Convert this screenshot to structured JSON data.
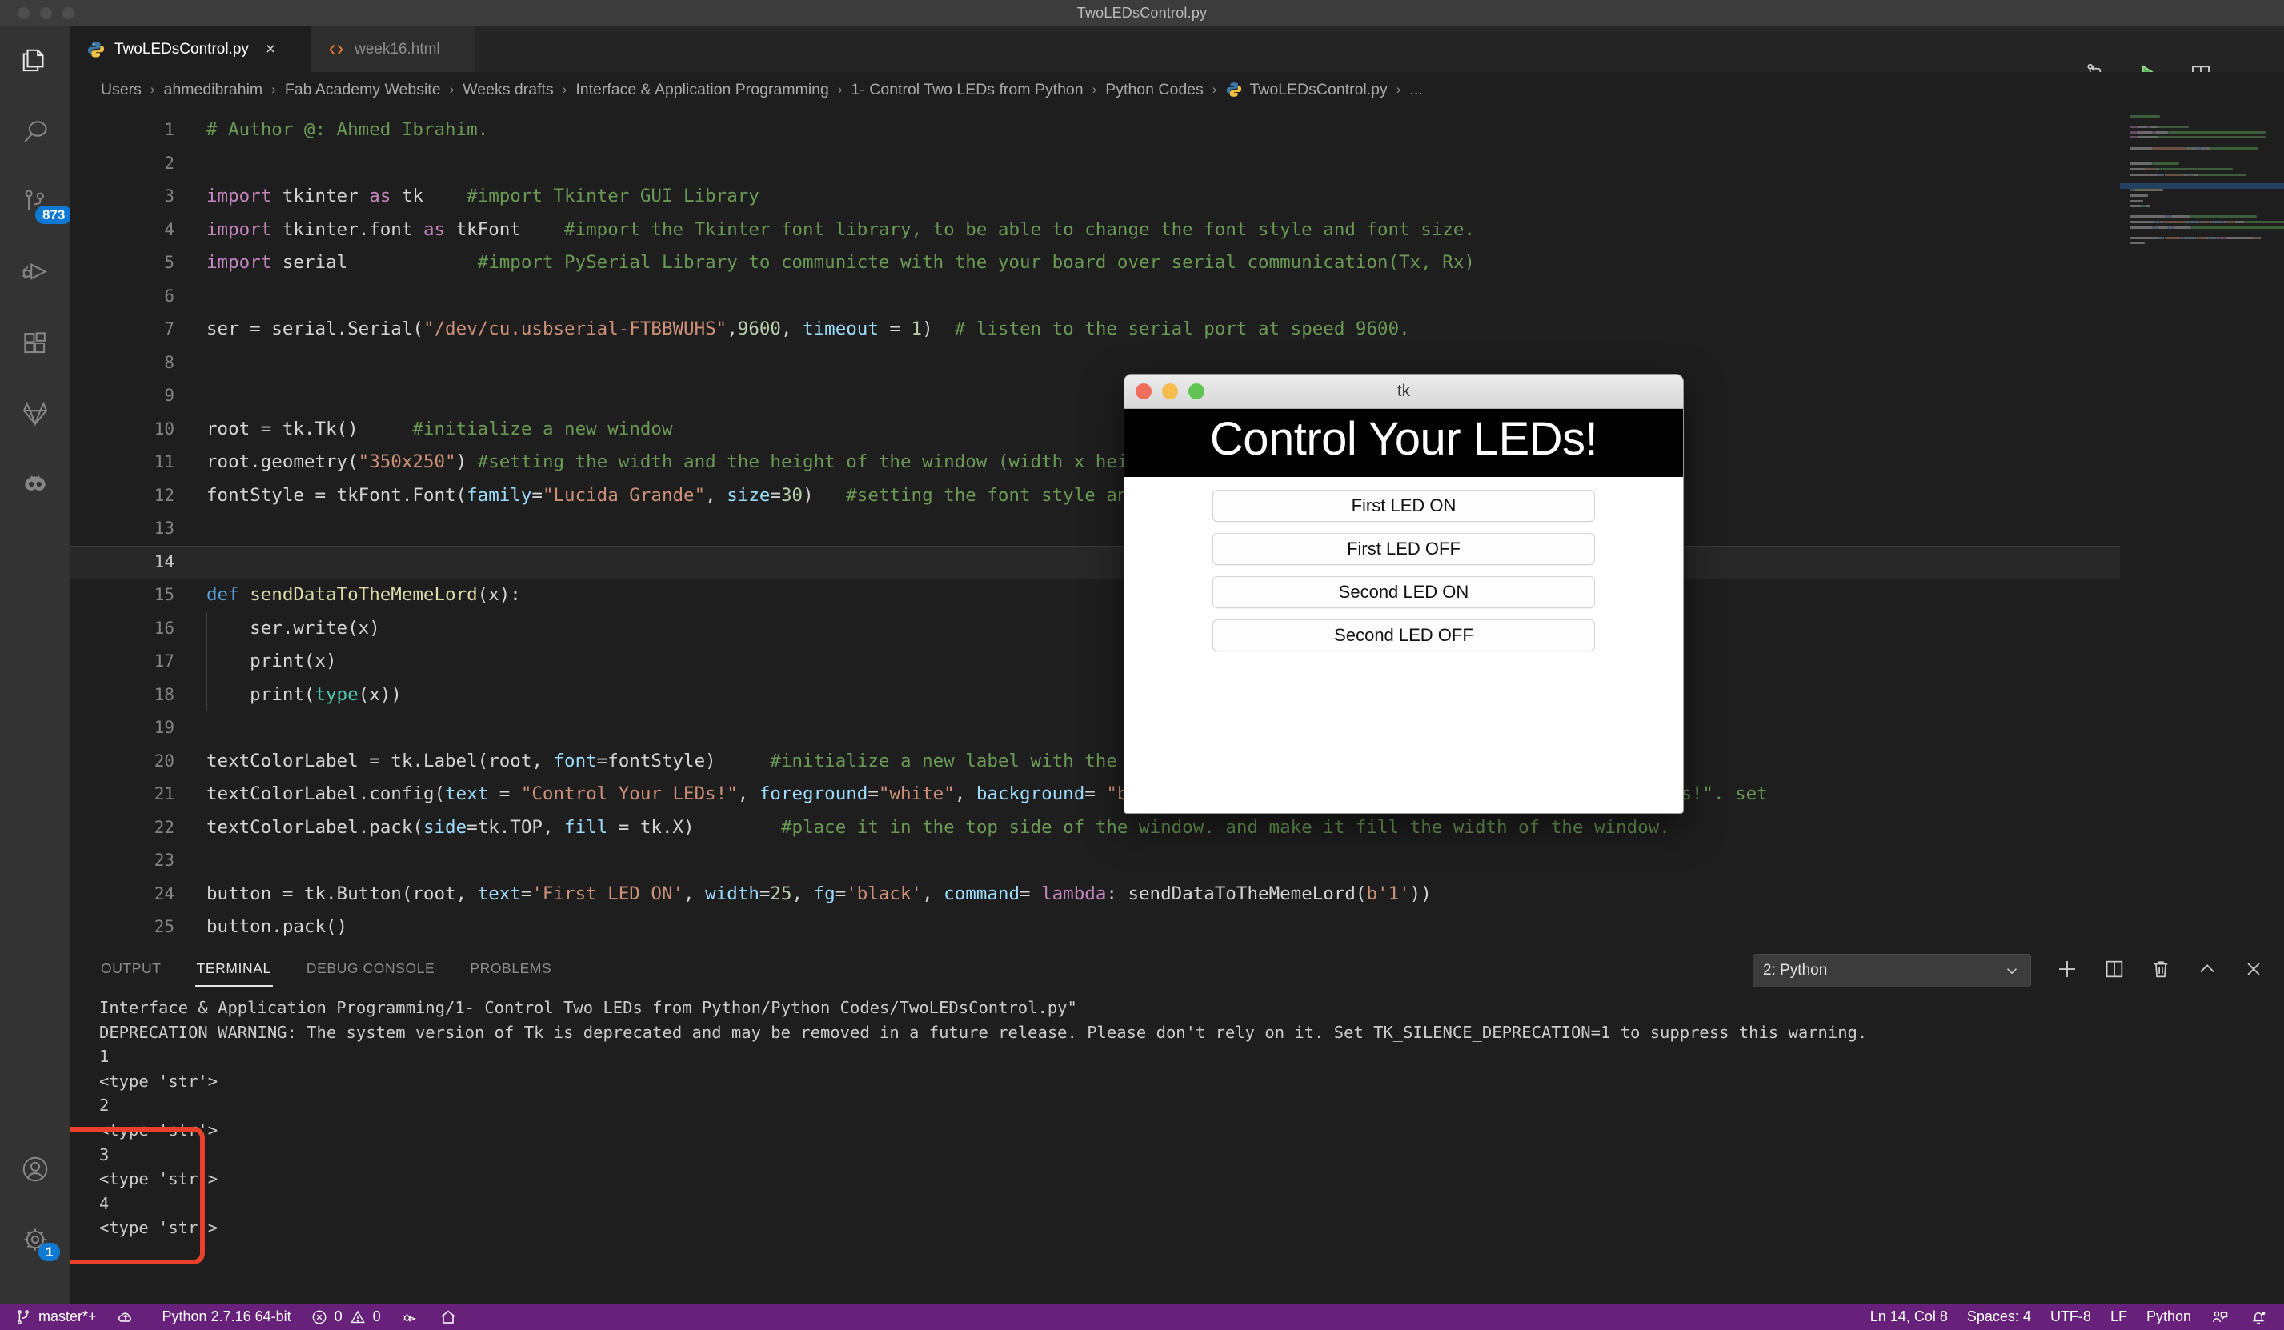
{
  "window": {
    "title": "TwoLEDsControl.py"
  },
  "tabs": [
    {
      "label": "TwoLEDsControl.py",
      "icon": "python-icon",
      "active": true,
      "close": "×"
    },
    {
      "label": "week16.html",
      "icon": "html-icon",
      "active": false
    }
  ],
  "editor_actions": [
    {
      "name": "source-control-compare-icon"
    },
    {
      "name": "run-python-file-icon"
    },
    {
      "name": "split-editor-icon"
    },
    {
      "name": "more-actions-icon",
      "label": "···"
    }
  ],
  "activitybar": {
    "items": [
      {
        "name": "explorer-icon",
        "label": "Explorer"
      },
      {
        "name": "search-icon",
        "label": "Search"
      },
      {
        "name": "source-control-icon",
        "label": "Source Control",
        "badge": "873"
      },
      {
        "name": "run-and-debug-icon",
        "label": "Run and Debug"
      },
      {
        "name": "extensions-icon",
        "label": "Extensions"
      },
      {
        "name": "gitlab-icon",
        "label": "GitLab"
      },
      {
        "name": "live-share-icon",
        "label": "Live Share"
      },
      {
        "name": "accounts-icon",
        "label": "Accounts"
      },
      {
        "name": "settings-gear-icon",
        "label": "Manage",
        "badge": "1"
      }
    ]
  },
  "breadcrumb": {
    "separator": "›",
    "items": [
      "Users",
      "ahmedibrahim",
      "Fab Academy Website",
      "Weeks drafts",
      "Interface & Application Programming",
      "1- Control Two LEDs from Python",
      "Python Codes",
      "TwoLEDsControl.py",
      "..."
    ]
  },
  "code": {
    "lines": [
      {
        "n": "1",
        "tokens": [
          {
            "t": "# Author @: Ahmed Ibrahim.",
            "c": "c-com"
          }
        ]
      },
      {
        "n": "2",
        "tokens": []
      },
      {
        "n": "3",
        "tokens": [
          {
            "t": "import",
            "c": "c-kw"
          },
          {
            "t": " tkinter ",
            "c": "c-pl"
          },
          {
            "t": "as",
            "c": "c-kw"
          },
          {
            "t": " tk    ",
            "c": "c-pl"
          },
          {
            "t": "#import Tkinter GUI Library",
            "c": "c-com"
          }
        ]
      },
      {
        "n": "4",
        "tokens": [
          {
            "t": "import",
            "c": "c-kw"
          },
          {
            "t": " tkinter.font ",
            "c": "c-pl"
          },
          {
            "t": "as",
            "c": "c-kw"
          },
          {
            "t": " tkFont    ",
            "c": "c-pl"
          },
          {
            "t": "#import the Tkinter font library, to be able to change the font style and font size.",
            "c": "c-com"
          }
        ]
      },
      {
        "n": "5",
        "tokens": [
          {
            "t": "import",
            "c": "c-kw"
          },
          {
            "t": " serial            ",
            "c": "c-pl"
          },
          {
            "t": "#import PySerial Library to communicte with the your board over serial communication(Tx, Rx)",
            "c": "c-com"
          }
        ]
      },
      {
        "n": "6",
        "tokens": []
      },
      {
        "n": "7",
        "tokens": [
          {
            "t": "ser = serial.Serial(",
            "c": "c-pl"
          },
          {
            "t": "\"/dev/cu.usbserial-FTBBWUHS\"",
            "c": "c-str"
          },
          {
            "t": ",",
            "c": "c-pl"
          },
          {
            "t": "9600",
            "c": "c-num"
          },
          {
            "t": ", ",
            "c": "c-pl"
          },
          {
            "t": "timeout",
            "c": "c-var"
          },
          {
            "t": " = ",
            "c": "c-pl"
          },
          {
            "t": "1",
            "c": "c-num"
          },
          {
            "t": ")  ",
            "c": "c-pl"
          },
          {
            "t": "# listen to the serial port at speed 9600.",
            "c": "c-com"
          }
        ]
      },
      {
        "n": "8",
        "tokens": []
      },
      {
        "n": "9",
        "tokens": []
      },
      {
        "n": "10",
        "tokens": [
          {
            "t": "root = tk.Tk()     ",
            "c": "c-pl"
          },
          {
            "t": "#initialize a new window",
            "c": "c-com"
          }
        ]
      },
      {
        "n": "11",
        "tokens": [
          {
            "t": "root.geometry(",
            "c": "c-pl"
          },
          {
            "t": "\"350x250\"",
            "c": "c-str"
          },
          {
            "t": ") ",
            "c": "c-pl"
          },
          {
            "t": "#setting the width and the height of the window (width x height)",
            "c": "c-com"
          }
        ]
      },
      {
        "n": "12",
        "tokens": [
          {
            "t": "fontStyle = tkFont.Font(",
            "c": "c-pl"
          },
          {
            "t": "family",
            "c": "c-var"
          },
          {
            "t": "=",
            "c": "c-pl"
          },
          {
            "t": "\"Lucida Grande\"",
            "c": "c-str"
          },
          {
            "t": ", ",
            "c": "c-pl"
          },
          {
            "t": "size",
            "c": "c-var"
          },
          {
            "t": "=",
            "c": "c-pl"
          },
          {
            "t": "30",
            "c": "c-num"
          },
          {
            "t": ")   ",
            "c": "c-pl"
          },
          {
            "t": "#setting the font style and the font size.",
            "c": "c-com"
          }
        ]
      },
      {
        "n": "13",
        "tokens": []
      },
      {
        "n": "14",
        "tokens": [],
        "highlight": true
      },
      {
        "n": "15",
        "tokens": [
          {
            "t": "def",
            "c": "c-kw2"
          },
          {
            "t": " ",
            "c": "c-pl"
          },
          {
            "t": "sendDataToTheMemeLord",
            "c": "c-fn"
          },
          {
            "t": "(x):",
            "c": "c-pl"
          }
        ]
      },
      {
        "n": "16",
        "tokens": [
          {
            "t": "    ser.write(x)",
            "c": "c-pl"
          }
        ],
        "guide": true
      },
      {
        "n": "17",
        "tokens": [
          {
            "t": "    print(x)",
            "c": "c-pl"
          }
        ],
        "guide": true
      },
      {
        "n": "18",
        "tokens": [
          {
            "t": "    print(",
            "c": "c-pl"
          },
          {
            "t": "type",
            "c": "c-type"
          },
          {
            "t": "(x))",
            "c": "c-pl"
          }
        ],
        "guide": true
      },
      {
        "n": "19",
        "tokens": []
      },
      {
        "n": "20",
        "tokens": [
          {
            "t": "textColorLabel = tk.Label(root, ",
            "c": "c-pl"
          },
          {
            "t": "font",
            "c": "c-var"
          },
          {
            "t": "=fontStyle)     ",
            "c": "c-pl"
          },
          {
            "t": "#initialize a new label with the font style we set before.",
            "c": "c-com"
          }
        ]
      },
      {
        "n": "21",
        "tokens": [
          {
            "t": "textColorLabel.config(",
            "c": "c-pl"
          },
          {
            "t": "text",
            "c": "c-var"
          },
          {
            "t": " = ",
            "c": "c-pl"
          },
          {
            "t": "\"Control Your LEDs!\"",
            "c": "c-str"
          },
          {
            "t": ", ",
            "c": "c-pl"
          },
          {
            "t": "foreground",
            "c": "c-var"
          },
          {
            "t": "=",
            "c": "c-pl"
          },
          {
            "t": "\"white\"",
            "c": "c-str"
          },
          {
            "t": ", ",
            "c": "c-pl"
          },
          {
            "t": "background",
            "c": "c-var"
          },
          {
            "t": "= ",
            "c": "c-pl"
          },
          {
            "t": "\"black\"",
            "c": "c-str"
          },
          {
            "t": ")        ",
            "c": "c-pl"
          },
          {
            "t": "#set the label name \"Control Your LEDs!\". set",
            "c": "c-com"
          }
        ]
      },
      {
        "n": "22",
        "tokens": [
          {
            "t": "textColorLabel.pack(",
            "c": "c-pl"
          },
          {
            "t": "side",
            "c": "c-var"
          },
          {
            "t": "=tk.TOP, ",
            "c": "c-pl"
          },
          {
            "t": "fill",
            "c": "c-var"
          },
          {
            "t": " = tk.X)        ",
            "c": "c-pl"
          },
          {
            "t": "#place it in the top side of the window. and make it fill the width of the window.",
            "c": "c-com"
          }
        ]
      },
      {
        "n": "23",
        "tokens": []
      },
      {
        "n": "24",
        "tokens": [
          {
            "t": "button = tk.Button(root, ",
            "c": "c-pl"
          },
          {
            "t": "text",
            "c": "c-var"
          },
          {
            "t": "=",
            "c": "c-pl"
          },
          {
            "t": "'First LED ON'",
            "c": "c-str"
          },
          {
            "t": ", ",
            "c": "c-pl"
          },
          {
            "t": "width",
            "c": "c-var"
          },
          {
            "t": "=",
            "c": "c-pl"
          },
          {
            "t": "25",
            "c": "c-num"
          },
          {
            "t": ", ",
            "c": "c-pl"
          },
          {
            "t": "fg",
            "c": "c-var"
          },
          {
            "t": "=",
            "c": "c-pl"
          },
          {
            "t": "'black'",
            "c": "c-str"
          },
          {
            "t": ", ",
            "c": "c-pl"
          },
          {
            "t": "command",
            "c": "c-var"
          },
          {
            "t": "= ",
            "c": "c-pl"
          },
          {
            "t": "lambda",
            "c": "c-kw"
          },
          {
            "t": ": sendDataToTheMemeLord(",
            "c": "c-pl"
          },
          {
            "t": "b'1'",
            "c": "c-str"
          },
          {
            "t": "))",
            "c": "c-pl"
          }
        ]
      },
      {
        "n": "25",
        "tokens": [
          {
            "t": "button.pack()",
            "c": "c-pl"
          }
        ]
      }
    ]
  },
  "tk_window": {
    "title": "tk",
    "heading": "Control Your LEDs!",
    "traffic": [
      {
        "name": "close-button",
        "color": "#ef6d5e"
      },
      {
        "name": "minimize-button",
        "color": "#f5bd4f"
      },
      {
        "name": "zoom-button",
        "color": "#61c454"
      }
    ],
    "buttons": [
      "First LED ON",
      "First LED OFF",
      "Second LED ON",
      "Second LED OFF"
    ]
  },
  "panel": {
    "tabs": [
      {
        "label": "OUTPUT",
        "active": false
      },
      {
        "label": "TERMINAL",
        "active": true
      },
      {
        "label": "DEBUG CONSOLE",
        "active": false
      },
      {
        "label": "PROBLEMS",
        "active": false
      }
    ],
    "terminal_select": {
      "value": "2: Python",
      "chevron": "∨"
    },
    "actions": [
      {
        "name": "new-terminal-icon",
        "label": "+"
      },
      {
        "name": "split-terminal-icon"
      },
      {
        "name": "kill-terminal-icon"
      },
      {
        "name": "maximize-panel-icon",
        "label": "⌃"
      },
      {
        "name": "close-panel-icon",
        "label": "✕"
      }
    ],
    "terminal_lines": [
      "Interface & Application Programming/1- Control Two LEDs from Python/Python Codes/TwoLEDsControl.py\"",
      "DEPRECATION WARNING: The system version of Tk is deprecated and may be removed in a future release. Please don't rely on it. Set TK_SILENCE_DEPRECATION=1 to suppress this warning.",
      "1",
      "<type 'str'>",
      "2",
      "<type 'str'>",
      "3",
      "<type 'str'>",
      "4",
      "<type 'str'>"
    ]
  },
  "statusbar": {
    "left": [
      {
        "name": "branch",
        "icon": "source-control-branch-icon",
        "label": "master*+"
      },
      {
        "name": "sync",
        "icon": "cloud-upload-icon",
        "label": ""
      },
      {
        "name": "interpreter",
        "icon": "",
        "label": "Python 2.7.16 64-bit"
      },
      {
        "name": "errors",
        "icon": "error-icon",
        "label": "0"
      },
      {
        "name": "warnings",
        "icon": "warning-icon",
        "label": "0"
      },
      {
        "name": "run-pytest",
        "icon": "run-tests-icon",
        "label": ""
      },
      {
        "name": "live-share-home",
        "icon": "home-icon",
        "label": ""
      }
    ],
    "right": [
      {
        "name": "cursor-position",
        "label": "Ln 14, Col 8"
      },
      {
        "name": "indentation",
        "label": "Spaces: 4"
      },
      {
        "name": "encoding",
        "label": "UTF-8"
      },
      {
        "name": "eol",
        "label": "LF"
      },
      {
        "name": "language-mode",
        "label": "Python"
      },
      {
        "name": "feedback-icon",
        "label": ""
      },
      {
        "name": "notifications-bell-icon",
        "label": ""
      }
    ]
  },
  "colors": {
    "statusbar_bg": "#68217a",
    "accent_blue": "#0e7ad4",
    "run_green": "#73c991",
    "redbox": "#e8402a"
  }
}
